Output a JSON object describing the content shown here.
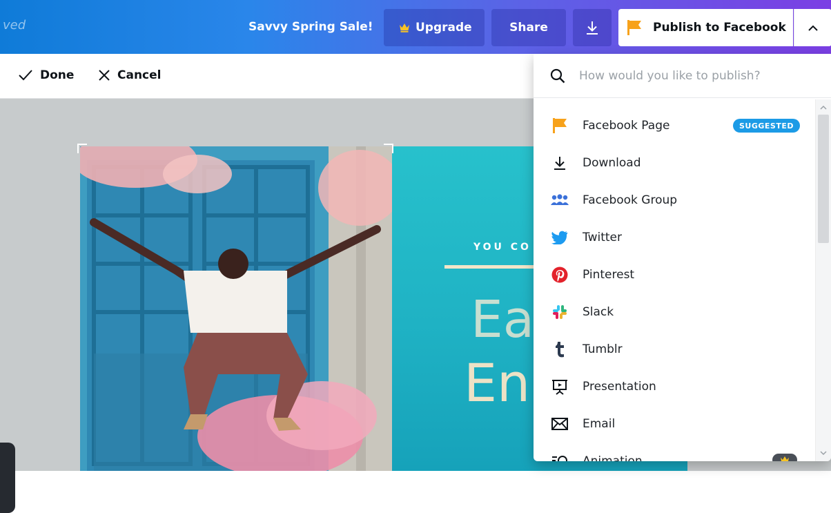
{
  "topbar": {
    "saved_fragment": "ved",
    "sale_label": "Savvy Spring Sale!",
    "upgrade_label": "Upgrade",
    "share_label": "Share",
    "publish_label": "Publish to Facebook"
  },
  "subbar": {
    "done_label": "Done",
    "cancel_label": "Cancel"
  },
  "design": {
    "kicker": "YOU CO",
    "big_line1": "Eat",
    "big_line2": "En"
  },
  "publish_menu": {
    "search_placeholder": "How would you like to publish?",
    "items": [
      {
        "label": "Facebook Page",
        "icon": "flag-icon",
        "badge": "SUGGESTED"
      },
      {
        "label": "Download",
        "icon": "download-icon"
      },
      {
        "label": "Facebook Group",
        "icon": "group-icon"
      },
      {
        "label": "Twitter",
        "icon": "twitter-icon"
      },
      {
        "label": "Pinterest",
        "icon": "pinterest-icon"
      },
      {
        "label": "Slack",
        "icon": "slack-icon"
      },
      {
        "label": "Tumblr",
        "icon": "tumblr-icon"
      },
      {
        "label": "Presentation",
        "icon": "presentation-icon"
      },
      {
        "label": "Email",
        "icon": "email-icon"
      },
      {
        "label": "Animation",
        "icon": "animation-icon"
      }
    ]
  },
  "colors": {
    "topbar_start": "#0f7bd8",
    "topbar_end": "#7b3fe4",
    "suggested_badge": "#1c9be6",
    "flag_orange": "#f7a21b",
    "teal_panel": "#22b8c8"
  }
}
